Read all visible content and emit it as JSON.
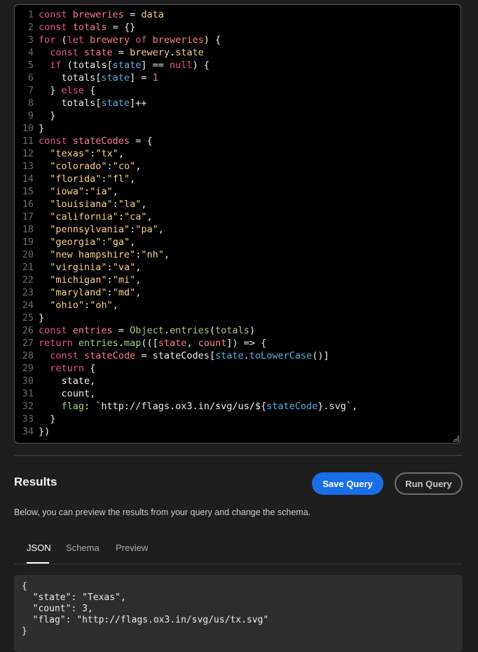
{
  "editor": {
    "lines": [
      {
        "num": "1",
        "tokens": [
          {
            "t": "const ",
            "c": "k"
          },
          {
            "t": "breweries",
            "c": "v"
          },
          {
            "t": " = ",
            "c": ""
          },
          {
            "t": "data",
            "c": "s"
          }
        ]
      },
      {
        "num": "2",
        "tokens": [
          {
            "t": "const ",
            "c": "k"
          },
          {
            "t": "totals",
            "c": "v"
          },
          {
            "t": " = {}",
            "c": ""
          }
        ]
      },
      {
        "num": "3",
        "tokens": [
          {
            "t": "for",
            "c": "k"
          },
          {
            "t": " (",
            "c": ""
          },
          {
            "t": "let ",
            "c": "k"
          },
          {
            "t": "brewery",
            "c": "v"
          },
          {
            "t": " of ",
            "c": "k"
          },
          {
            "t": "breweries",
            "c": "v"
          },
          {
            "t": ") {",
            "c": ""
          }
        ]
      },
      {
        "num": "4",
        "tokens": [
          {
            "t": "  ",
            "c": ""
          },
          {
            "t": "const ",
            "c": "k"
          },
          {
            "t": "state",
            "c": "v"
          },
          {
            "t": " = ",
            "c": ""
          },
          {
            "t": "brewery",
            "c": "s"
          },
          {
            "t": ".",
            "c": ""
          },
          {
            "t": "state",
            "c": "s"
          }
        ]
      },
      {
        "num": "5",
        "tokens": [
          {
            "t": "  ",
            "c": ""
          },
          {
            "t": "if",
            "c": "k"
          },
          {
            "t": " (totals[",
            "c": ""
          },
          {
            "t": "state",
            "c": "p"
          },
          {
            "t": "] == ",
            "c": ""
          },
          {
            "t": "null",
            "c": "k"
          },
          {
            "t": ") {",
            "c": ""
          }
        ]
      },
      {
        "num": "6",
        "tokens": [
          {
            "t": "    totals[",
            "c": ""
          },
          {
            "t": "state",
            "c": "p"
          },
          {
            "t": "] = ",
            "c": ""
          },
          {
            "t": "1",
            "c": "n"
          }
        ]
      },
      {
        "num": "7",
        "tokens": [
          {
            "t": "  } ",
            "c": ""
          },
          {
            "t": "else",
            "c": "k"
          },
          {
            "t": " {",
            "c": ""
          }
        ]
      },
      {
        "num": "8",
        "tokens": [
          {
            "t": "    totals[",
            "c": ""
          },
          {
            "t": "state",
            "c": "p"
          },
          {
            "t": "]++",
            "c": ""
          }
        ]
      },
      {
        "num": "9",
        "tokens": [
          {
            "t": "  }",
            "c": ""
          }
        ]
      },
      {
        "num": "10",
        "tokens": [
          {
            "t": "}",
            "c": ""
          }
        ]
      },
      {
        "num": "11",
        "tokens": [
          {
            "t": "const ",
            "c": "k"
          },
          {
            "t": "stateCodes",
            "c": "v"
          },
          {
            "t": " = {",
            "c": ""
          }
        ]
      },
      {
        "num": "12",
        "tokens": [
          {
            "t": "  ",
            "c": ""
          },
          {
            "t": "\"texas\"",
            "c": "s"
          },
          {
            "t": ":",
            "c": ""
          },
          {
            "t": "\"tx\"",
            "c": "s"
          },
          {
            "t": ",",
            "c": ""
          }
        ]
      },
      {
        "num": "13",
        "tokens": [
          {
            "t": "  ",
            "c": ""
          },
          {
            "t": "\"colorado\"",
            "c": "s"
          },
          {
            "t": ":",
            "c": ""
          },
          {
            "t": "\"co\"",
            "c": "s"
          },
          {
            "t": ",",
            "c": ""
          }
        ]
      },
      {
        "num": "14",
        "tokens": [
          {
            "t": "  ",
            "c": ""
          },
          {
            "t": "\"florida\"",
            "c": "s"
          },
          {
            "t": ":",
            "c": ""
          },
          {
            "t": "\"fl\"",
            "c": "s"
          },
          {
            "t": ",",
            "c": ""
          }
        ]
      },
      {
        "num": "15",
        "tokens": [
          {
            "t": "  ",
            "c": ""
          },
          {
            "t": "\"iowa\"",
            "c": "s"
          },
          {
            "t": ":",
            "c": ""
          },
          {
            "t": "\"ia\"",
            "c": "s"
          },
          {
            "t": ",",
            "c": ""
          }
        ]
      },
      {
        "num": "16",
        "tokens": [
          {
            "t": "  ",
            "c": ""
          },
          {
            "t": "\"louisiana\"",
            "c": "s"
          },
          {
            "t": ":",
            "c": ""
          },
          {
            "t": "\"la\"",
            "c": "s"
          },
          {
            "t": ",",
            "c": ""
          }
        ]
      },
      {
        "num": "17",
        "tokens": [
          {
            "t": "  ",
            "c": ""
          },
          {
            "t": "\"california\"",
            "c": "s"
          },
          {
            "t": ":",
            "c": ""
          },
          {
            "t": "\"ca\"",
            "c": "s"
          },
          {
            "t": ",",
            "c": ""
          }
        ]
      },
      {
        "num": "18",
        "tokens": [
          {
            "t": "  ",
            "c": ""
          },
          {
            "t": "\"pennsylvania\"",
            "c": "s"
          },
          {
            "t": ":",
            "c": ""
          },
          {
            "t": "\"pa\"",
            "c": "s"
          },
          {
            "t": ",",
            "c": ""
          }
        ]
      },
      {
        "num": "19",
        "tokens": [
          {
            "t": "  ",
            "c": ""
          },
          {
            "t": "\"georgia\"",
            "c": "s"
          },
          {
            "t": ":",
            "c": ""
          },
          {
            "t": "\"ga\"",
            "c": "s"
          },
          {
            "t": ",",
            "c": ""
          }
        ]
      },
      {
        "num": "20",
        "tokens": [
          {
            "t": "  ",
            "c": ""
          },
          {
            "t": "\"new hampshire\"",
            "c": "s"
          },
          {
            "t": ":",
            "c": ""
          },
          {
            "t": "\"nh\"",
            "c": "s"
          },
          {
            "t": ",",
            "c": ""
          }
        ]
      },
      {
        "num": "21",
        "tokens": [
          {
            "t": "  ",
            "c": ""
          },
          {
            "t": "\"virginia\"",
            "c": "s"
          },
          {
            "t": ":",
            "c": ""
          },
          {
            "t": "\"va\"",
            "c": "s"
          },
          {
            "t": ",",
            "c": ""
          }
        ]
      },
      {
        "num": "22",
        "tokens": [
          {
            "t": "  ",
            "c": ""
          },
          {
            "t": "\"michigan\"",
            "c": "s"
          },
          {
            "t": ":",
            "c": ""
          },
          {
            "t": "\"mi\"",
            "c": "s"
          },
          {
            "t": ",",
            "c": ""
          }
        ]
      },
      {
        "num": "23",
        "tokens": [
          {
            "t": "  ",
            "c": ""
          },
          {
            "t": "\"maryland\"",
            "c": "s"
          },
          {
            "t": ":",
            "c": ""
          },
          {
            "t": "\"md\"",
            "c": "s"
          },
          {
            "t": ",",
            "c": ""
          }
        ]
      },
      {
        "num": "24",
        "tokens": [
          {
            "t": "  ",
            "c": ""
          },
          {
            "t": "\"ohio\"",
            "c": "s"
          },
          {
            "t": ":",
            "c": ""
          },
          {
            "t": "\"oh\"",
            "c": "s"
          },
          {
            "t": ",",
            "c": ""
          }
        ]
      },
      {
        "num": "25",
        "tokens": [
          {
            "t": "}",
            "c": ""
          }
        ]
      },
      {
        "num": "26",
        "tokens": [
          {
            "t": "const ",
            "c": "k"
          },
          {
            "t": "entries",
            "c": "v"
          },
          {
            "t": " = ",
            "c": ""
          },
          {
            "t": "Object",
            "c": "f"
          },
          {
            "t": ".",
            "c": ""
          },
          {
            "t": "entries",
            "c": "f"
          },
          {
            "t": "(",
            "c": ""
          },
          {
            "t": "totals",
            "c": "f"
          },
          {
            "t": ")",
            "c": ""
          }
        ]
      },
      {
        "num": "27",
        "tokens": [
          {
            "t": "return ",
            "c": "k"
          },
          {
            "t": "entries",
            "c": "f"
          },
          {
            "t": ".",
            "c": ""
          },
          {
            "t": "map",
            "c": "f"
          },
          {
            "t": "(([",
            "c": ""
          },
          {
            "t": "state",
            "c": "v"
          },
          {
            "t": ", ",
            "c": ""
          },
          {
            "t": "count",
            "c": "v"
          },
          {
            "t": "]) => {",
            "c": ""
          }
        ]
      },
      {
        "num": "28",
        "tokens": [
          {
            "t": "  ",
            "c": ""
          },
          {
            "t": "const ",
            "c": "k"
          },
          {
            "t": "stateCode",
            "c": "v"
          },
          {
            "t": " = stateCodes[",
            "c": ""
          },
          {
            "t": "state",
            "c": "p"
          },
          {
            "t": ".",
            "c": ""
          },
          {
            "t": "toLowerCase",
            "c": "p"
          },
          {
            "t": "()]",
            "c": ""
          }
        ]
      },
      {
        "num": "29",
        "tokens": [
          {
            "t": "  ",
            "c": ""
          },
          {
            "t": "return",
            "c": "k"
          },
          {
            "t": " {",
            "c": ""
          }
        ]
      },
      {
        "num": "30",
        "tokens": [
          {
            "t": "    state,",
            "c": ""
          }
        ]
      },
      {
        "num": "31",
        "tokens": [
          {
            "t": "    count,",
            "c": ""
          }
        ]
      },
      {
        "num": "32",
        "tokens": [
          {
            "t": "    ",
            "c": ""
          },
          {
            "t": "flag",
            "c": "f"
          },
          {
            "t": ": `http://flags.ox3.in/svg/us/${",
            "c": ""
          },
          {
            "t": "stateCode",
            "c": "p"
          },
          {
            "t": "}.svg`,",
            "c": ""
          }
        ]
      },
      {
        "num": "33",
        "tokens": [
          {
            "t": "  }",
            "c": ""
          }
        ]
      },
      {
        "num": "34",
        "tokens": [
          {
            "t": "})",
            "c": ""
          }
        ]
      }
    ]
  },
  "results": {
    "title": "Results",
    "save_label": "Save Query",
    "run_label": "Run Query",
    "description": "Below, you can preview the results from your query and change the schema.",
    "tabs": [
      {
        "label": "JSON",
        "active": true
      },
      {
        "label": "Schema",
        "active": false
      },
      {
        "label": "Preview",
        "active": false
      }
    ],
    "json_preview": "{\n  \"state\": \"Texas\",\n  \"count\": 3,\n  \"flag\": \"http://flags.ox3.in/svg/us/tx.svg\"\n}"
  },
  "colors": {
    "accent": "#1a6ee8",
    "background": "#1e1e1e",
    "editor_background": "#000000"
  }
}
